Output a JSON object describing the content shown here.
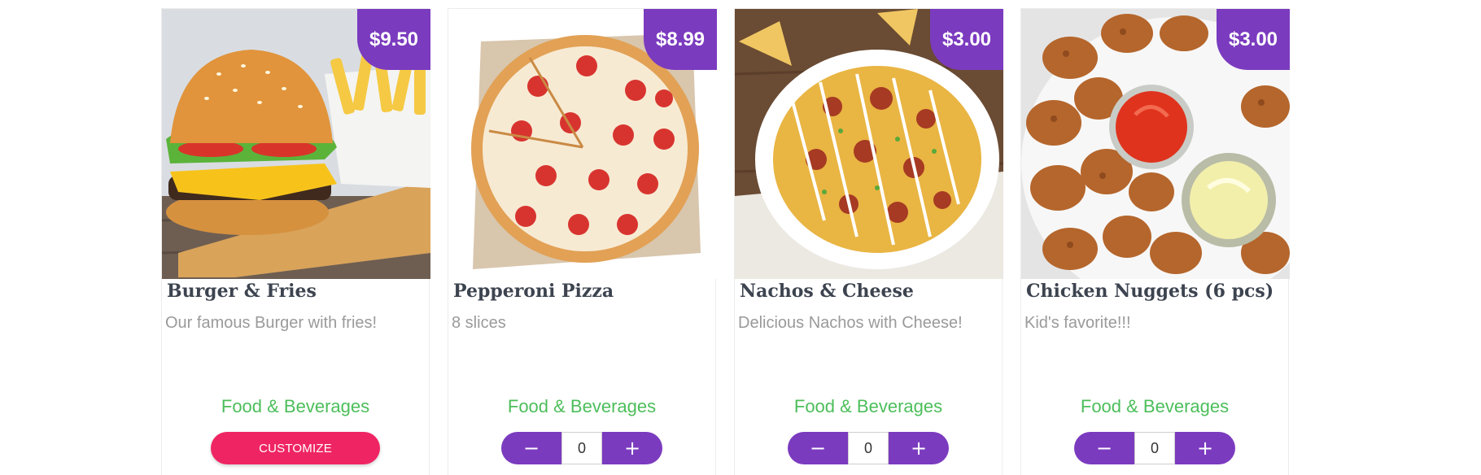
{
  "products": [
    {
      "title": "Burger & Fries",
      "description": "Our famous Burger with fries!",
      "price": "$9.50",
      "category": "Food & Beverages",
      "action": "customize",
      "customize_label": "CUSTOMIZE",
      "image_icon": "burger-fries-photo"
    },
    {
      "title": "Pepperoni Pizza",
      "description": "8 slices",
      "price": "$8.99",
      "category": "Food & Beverages",
      "action": "stepper",
      "quantity": "0",
      "minus_label": "−",
      "plus_label": "+",
      "image_icon": "pepperoni-pizza-photo"
    },
    {
      "title": "Nachos & Cheese",
      "description": "Delicious Nachos with Cheese!",
      "price": "$3.00",
      "category": "Food & Beverages",
      "action": "stepper",
      "quantity": "0",
      "minus_label": "−",
      "plus_label": "+",
      "image_icon": "nachos-cheese-photo"
    },
    {
      "title": "Chicken Nuggets (6 pcs)",
      "description": "Kid's favorite!!!",
      "price": "$3.00",
      "category": "Food & Beverages",
      "action": "stepper",
      "quantity": "0",
      "minus_label": "−",
      "plus_label": "+",
      "image_icon": "chicken-nuggets-photo"
    }
  ],
  "colors": {
    "price_badge": "#7b3bbf",
    "stepper": "#7b3bbf",
    "customize": "#ef2563",
    "category": "#4cbe5a",
    "title": "#3d4450",
    "description": "#9a9a9a"
  }
}
